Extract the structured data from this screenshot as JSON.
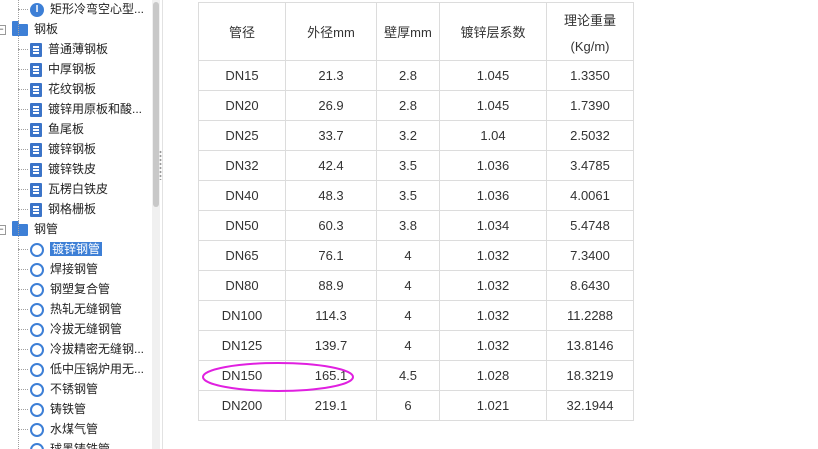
{
  "tree": {
    "items": [
      {
        "label": "矩形冷弯空心型...",
        "icon": "i-beam-icon",
        "level": 2
      },
      {
        "label": "钢板",
        "icon": "folder-icon",
        "level": 1
      },
      {
        "label": "普通薄钢板",
        "icon": "document-icon",
        "level": 2
      },
      {
        "label": "中厚钢板",
        "icon": "document-icon",
        "level": 2
      },
      {
        "label": "花纹钢板",
        "icon": "document-icon",
        "level": 2
      },
      {
        "label": "镀锌用原板和酸...",
        "icon": "document-icon",
        "level": 2
      },
      {
        "label": "鱼尾板",
        "icon": "document-icon",
        "level": 2
      },
      {
        "label": "镀锌钢板",
        "icon": "document-icon",
        "level": 2
      },
      {
        "label": "镀锌铁皮",
        "icon": "document-icon",
        "level": 2
      },
      {
        "label": "瓦楞白铁皮",
        "icon": "document-icon",
        "level": 2
      },
      {
        "label": "钢格栅板",
        "icon": "document-icon",
        "level": 2
      },
      {
        "label": "钢管",
        "icon": "folder-icon",
        "level": 1
      },
      {
        "label": "镀锌钢管",
        "icon": "ring-icon",
        "level": 2,
        "selected": true
      },
      {
        "label": "焊接钢管",
        "icon": "ring-icon",
        "level": 2
      },
      {
        "label": "钢塑复合管",
        "icon": "ring-icon",
        "level": 2
      },
      {
        "label": "热轧无缝钢管",
        "icon": "ring-icon",
        "level": 2
      },
      {
        "label": "冷拔无缝钢管",
        "icon": "ring-icon",
        "level": 2
      },
      {
        "label": "冷拔精密无缝钢...",
        "icon": "ring-icon",
        "level": 2
      },
      {
        "label": "低中压锅炉用无...",
        "icon": "ring-icon",
        "level": 2
      },
      {
        "label": "不锈钢管",
        "icon": "ring-icon",
        "level": 2
      },
      {
        "label": "铸铁管",
        "icon": "ring-icon",
        "level": 2
      },
      {
        "label": "水煤气管",
        "icon": "ring-icon",
        "level": 2
      },
      {
        "label": "球墨铸铁管",
        "icon": "ring-icon",
        "level": 2
      }
    ]
  },
  "table": {
    "headers": [
      "管径",
      "外径mm",
      "壁厚mm",
      "镀锌层系数",
      "理论重量",
      "(Kg/m)"
    ],
    "rows": [
      [
        "DN15",
        "21.3",
        "2.8",
        "1.045",
        "1.3350"
      ],
      [
        "DN20",
        "26.9",
        "2.8",
        "1.045",
        "1.7390"
      ],
      [
        "DN25",
        "33.7",
        "3.2",
        "1.04",
        "2.5032"
      ],
      [
        "DN32",
        "42.4",
        "3.5",
        "1.036",
        "3.4785"
      ],
      [
        "DN40",
        "48.3",
        "3.5",
        "1.036",
        "4.0061"
      ],
      [
        "DN50",
        "60.3",
        "3.8",
        "1.034",
        "5.4748"
      ],
      [
        "DN65",
        "76.1",
        "4",
        "1.032",
        "7.3400"
      ],
      [
        "DN80",
        "88.9",
        "4",
        "1.032",
        "8.6430"
      ],
      [
        "DN100",
        "114.3",
        "4",
        "1.032",
        "11.2288"
      ],
      [
        "DN125",
        "139.7",
        "4",
        "1.032",
        "13.8146"
      ],
      [
        "DN150",
        "165.1",
        "4.5",
        "1.028",
        "18.3219"
      ],
      [
        "DN200",
        "219.1",
        "6",
        "1.021",
        "32.1944"
      ]
    ]
  },
  "annotation": {
    "shape": "ellipse",
    "color": "#e020e0",
    "highlight_row": "DN150"
  },
  "colors": {
    "accent": "#3d7fd6",
    "selection": "#3d7fd6",
    "grid": "#dcdcdc"
  }
}
